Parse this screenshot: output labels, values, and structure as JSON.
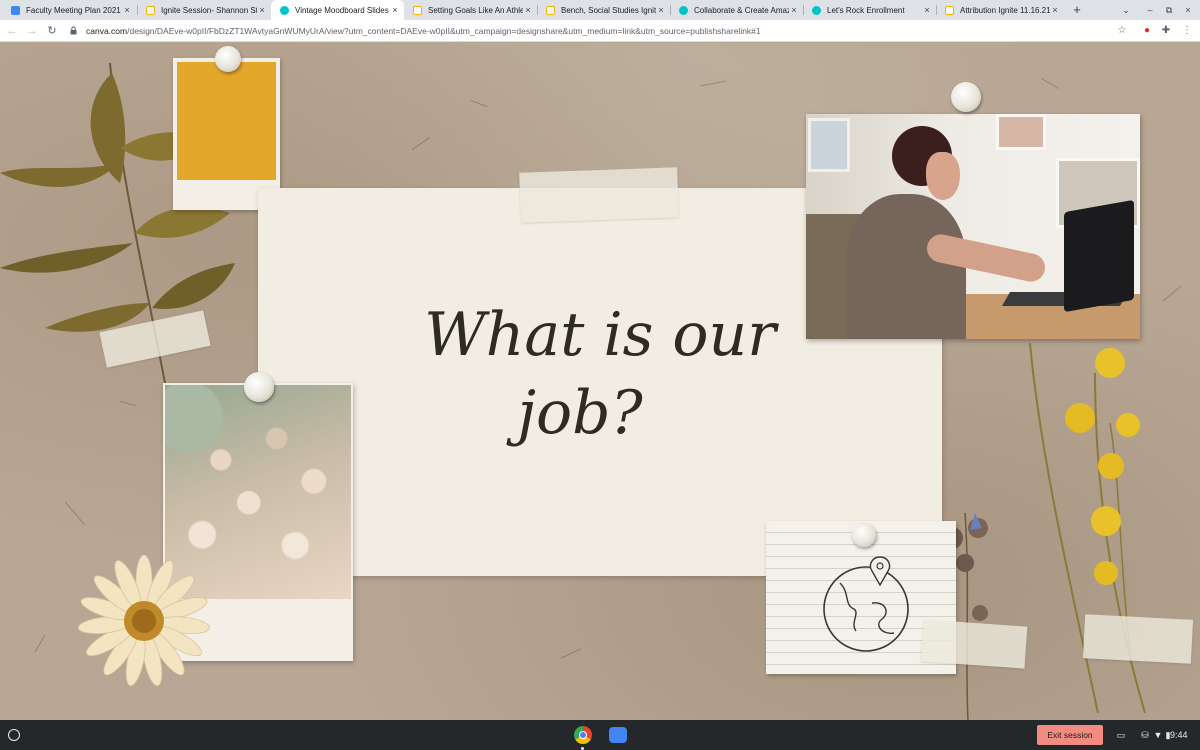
{
  "browser": {
    "tabs": [
      {
        "title": "Faculty Meeting Plan 2021",
        "favicon": "docs-icon",
        "active": false
      },
      {
        "title": "Ignite Session- Shannon St",
        "favicon": "slides-icon",
        "active": false
      },
      {
        "title": "Vintage Moodboard Slides",
        "favicon": "canva-icon",
        "active": true
      },
      {
        "title": "Setting Goals Like An Athle",
        "favicon": "slides-icon",
        "active": false
      },
      {
        "title": "Bench, Social Studies Ignite",
        "favicon": "slides-icon",
        "active": false
      },
      {
        "title": "Collaborate & Create Amaz",
        "favicon": "canva-icon",
        "active": false
      },
      {
        "title": "Let's Rock Enrollment",
        "favicon": "canva-icon",
        "active": false
      },
      {
        "title": "Attribution Ignite 11.16.21",
        "favicon": "slides-icon",
        "active": false
      }
    ],
    "tab_close_glyph": "×",
    "new_tab_glyph": "+",
    "strip_controls": [
      "⌄",
      "–",
      "⧉",
      "×"
    ],
    "nav": {
      "back": "←",
      "forward": "→",
      "reload": "↻"
    },
    "url_host": "canva.com",
    "url_path": "/design/DAEve-w0pII/FbDzZT1WAvtyaGnWUMyUrA/view?utm_content=DAEve-w0pII&utm_campaign=designshare&utm_medium=link&utm_source=publishsharelink#1",
    "toolbar_icons": [
      "☆",
      "●",
      "✚",
      "⋮"
    ]
  },
  "slide": {
    "headline_line1": "What is our",
    "headline_line2": "job?",
    "colors": {
      "kraft": "#b8a794",
      "card": "#f2ede2",
      "mustard": "#e3a82b",
      "ink": "#2e2a24"
    }
  },
  "shelf": {
    "exit_label": "Exit session",
    "time": "9:44",
    "tray_icons": [
      "▭",
      "⛁",
      "▼",
      "▮"
    ]
  }
}
